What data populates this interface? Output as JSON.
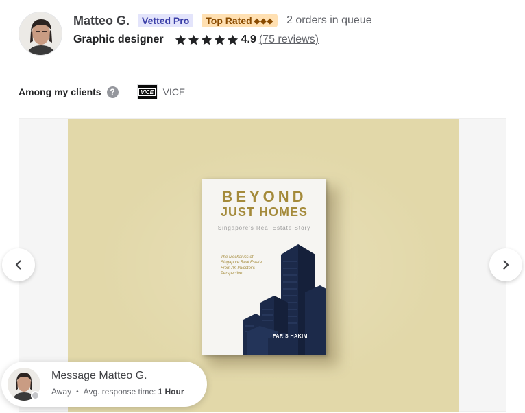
{
  "seller": {
    "name": "Matteo G.",
    "badge_vetted": "Vetted Pro",
    "badge_top": "Top Rated",
    "badge_top_diamonds": "◆◆◆",
    "queue": "2 orders in queue",
    "title": "Graphic designer",
    "rating": "4.9",
    "rating_stars": 5,
    "reviews": "(75 reviews)"
  },
  "clients": {
    "label": "Among my clients",
    "help": "?",
    "logo_text": "VICE",
    "name": "VICE"
  },
  "book": {
    "title_line1": "BEYOND",
    "title_line2": "JUST HOMES",
    "subtitle": "Singapore's Real Estate Story",
    "blurb": "The Mechanics of Singapore Real Estate From An Investor's Perspective",
    "author": "FARIS HAKIM"
  },
  "message": {
    "title": "Message Matteo G.",
    "status": "Away",
    "separator": "•",
    "response_label": "Avg. response time:",
    "response_value": "1 Hour"
  },
  "colors": {
    "accent_vetted_bg": "#e3e4fb",
    "accent_top_bg": "#ffe0b2",
    "slide_bg": "#e2d8a9",
    "book_gold": "#a48a3a",
    "building_navy": "#1c2a4a"
  },
  "icons": {
    "prev": "chevron-left-icon",
    "next": "chevron-right-icon",
    "star": "star-icon",
    "help": "question-circle-icon"
  }
}
